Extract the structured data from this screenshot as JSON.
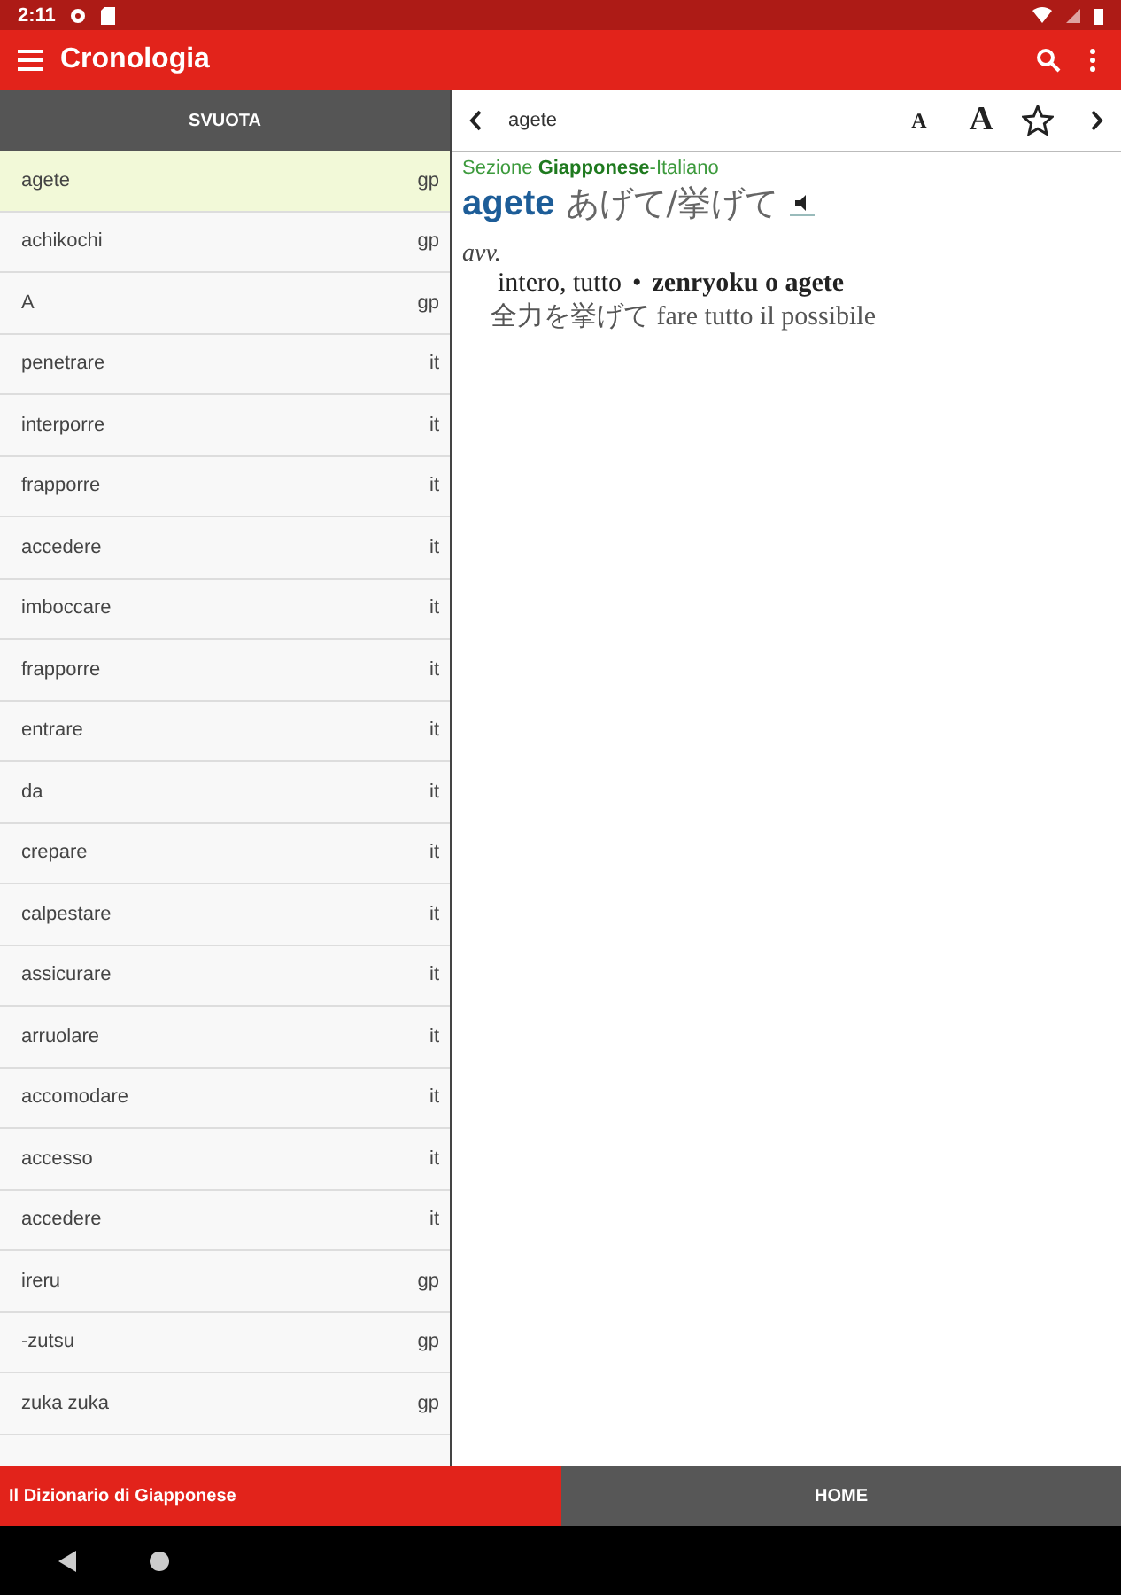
{
  "status_bar": {
    "time": "2:11"
  },
  "app_bar": {
    "title": "Cronologia"
  },
  "history": {
    "clear_button": "SVUOTA",
    "items": [
      {
        "word": "agete",
        "lang": "gp",
        "selected": true
      },
      {
        "word": "achikochi",
        "lang": "gp",
        "selected": false
      },
      {
        "word": "A",
        "lang": "gp",
        "selected": false
      },
      {
        "word": "penetrare",
        "lang": "it",
        "selected": false
      },
      {
        "word": "interporre",
        "lang": "it",
        "selected": false
      },
      {
        "word": "frapporre",
        "lang": "it",
        "selected": false
      },
      {
        "word": "accedere",
        "lang": "it",
        "selected": false
      },
      {
        "word": "imboccare",
        "lang": "it",
        "selected": false
      },
      {
        "word": "frapporre",
        "lang": "it",
        "selected": false
      },
      {
        "word": "entrare",
        "lang": "it",
        "selected": false
      },
      {
        "word": "da",
        "lang": "it",
        "selected": false
      },
      {
        "word": "crepare",
        "lang": "it",
        "selected": false
      },
      {
        "word": "calpestare",
        "lang": "it",
        "selected": false
      },
      {
        "word": "assicurare",
        "lang": "it",
        "selected": false
      },
      {
        "word": "arruolare",
        "lang": "it",
        "selected": false
      },
      {
        "word": "accomodare",
        "lang": "it",
        "selected": false
      },
      {
        "word": "accesso",
        "lang": "it",
        "selected": false
      },
      {
        "word": "accedere",
        "lang": "it",
        "selected": false
      },
      {
        "word": "ireru",
        "lang": "gp",
        "selected": false
      },
      {
        "word": "-zutsu",
        "lang": "gp",
        "selected": false
      },
      {
        "word": "zuka zuka",
        "lang": "gp",
        "selected": false
      }
    ]
  },
  "entry_toolbar": {
    "query": "agete",
    "font_small": "A",
    "font_large": "A",
    "favorite": false
  },
  "entry": {
    "section": "Sezione **Giapponese**-Italiano",
    "headword": "agete",
    "reading": "あげて/挙げて",
    "pos": "avv.",
    "meaning": "intero, tutto",
    "bullet": "•",
    "phrase": "zenryoku o agete",
    "example": "全力を挙げて fare tutto il possibile"
  },
  "bottom_bar": {
    "app_name": "Il Dizionario di Giapponese",
    "home_button": "HOME"
  }
}
